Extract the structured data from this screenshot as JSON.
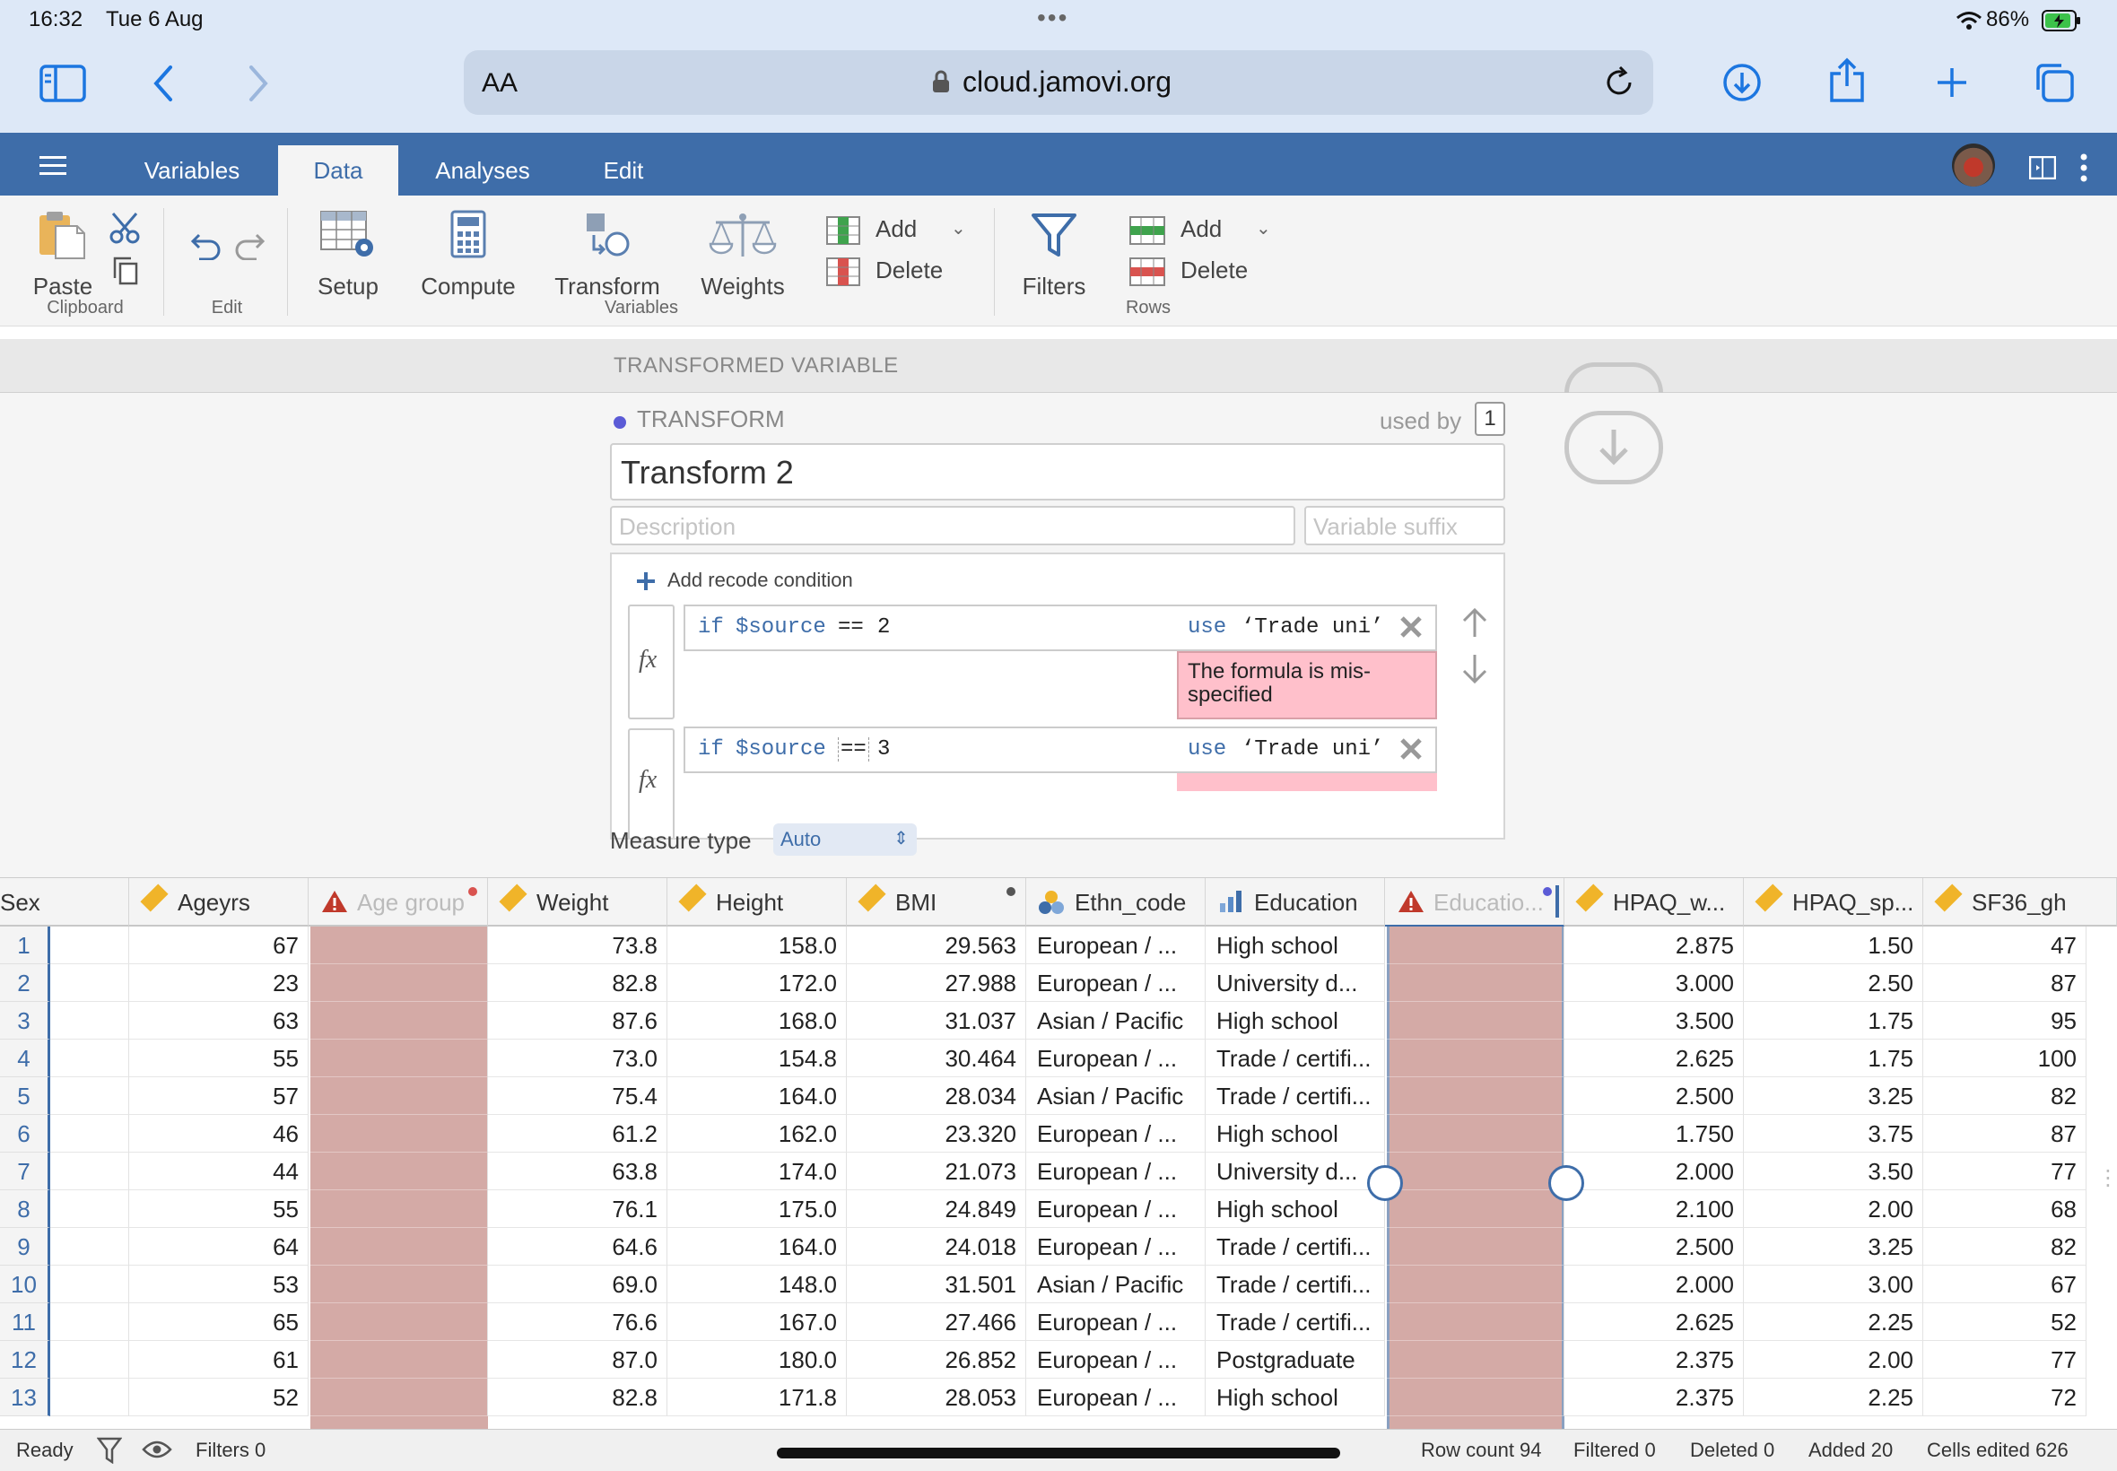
{
  "status": {
    "time": "16:32",
    "date": "Tue 6 Aug",
    "battery": "86%"
  },
  "browser": {
    "aa": "AA",
    "url": "cloud.jamovi.org"
  },
  "tabs": [
    {
      "label": "Variables",
      "active": false
    },
    {
      "label": "Data",
      "active": true
    },
    {
      "label": "Analyses",
      "active": false
    },
    {
      "label": "Edit",
      "active": false
    }
  ],
  "toolbar": {
    "paste": "Paste",
    "clipboard": "Clipboard",
    "edit": "Edit",
    "setup": "Setup",
    "compute": "Compute",
    "transform": "Transform",
    "weights": "Weights",
    "add_var": "Add",
    "delete_var": "Delete",
    "variables": "Variables",
    "filters": "Filters",
    "add_row": "Add",
    "delete_row": "Delete",
    "rows": "Rows"
  },
  "panel": {
    "header": "TRANSFORMED VARIABLE",
    "transform_label": "TRANSFORM",
    "used_by": "used by",
    "used_by_count": "1",
    "name": "Transform 2",
    "description_placeholder": "Description",
    "suffix_placeholder": "Variable suffix",
    "add_condition": "Add recode condition",
    "conditions": [
      {
        "kw": "if",
        "var": "$source",
        "op": "==",
        "val": "2",
        "use": "use",
        "result": "‘Trade uni’",
        "error": "The formula is mis-specified"
      },
      {
        "kw": "if",
        "var": "$source",
        "op": "==",
        "val": "3",
        "use": "use",
        "result": "‘Trade uni’",
        "error": ""
      }
    ],
    "measure_label": "Measure type",
    "measure_value": "Auto"
  },
  "grid": {
    "columns": [
      "Sex",
      "Ageyrs",
      "Age group",
      "Weight",
      "Height",
      "BMI",
      "Ethn_code",
      "Education",
      "Educatio...",
      "HPAQ_w...",
      "HPAQ_sp...",
      "SF36_gh"
    ],
    "rows": [
      {
        "n": "1",
        "age": "67",
        "weight": "73.8",
        "height": "158.0",
        "bmi": "29.563",
        "ethn": "European / ...",
        "edu": "High school",
        "hw": "2.875",
        "hs": "1.50",
        "sf": "47"
      },
      {
        "n": "2",
        "age": "23",
        "weight": "82.8",
        "height": "172.0",
        "bmi": "27.988",
        "ethn": "European / ...",
        "edu": "University d...",
        "hw": "3.000",
        "hs": "2.50",
        "sf": "87"
      },
      {
        "n": "3",
        "age": "63",
        "weight": "87.6",
        "height": "168.0",
        "bmi": "31.037",
        "ethn": "Asian / Pacific",
        "edu": "High school",
        "hw": "3.500",
        "hs": "1.75",
        "sf": "95"
      },
      {
        "n": "4",
        "age": "55",
        "weight": "73.0",
        "height": "154.8",
        "bmi": "30.464",
        "ethn": "European / ...",
        "edu": "Trade / certifi...",
        "hw": "2.625",
        "hs": "1.75",
        "sf": "100"
      },
      {
        "n": "5",
        "age": "57",
        "weight": "75.4",
        "height": "164.0",
        "bmi": "28.034",
        "ethn": "Asian / Pacific",
        "edu": "Trade / certifi...",
        "hw": "2.500",
        "hs": "3.25",
        "sf": "82"
      },
      {
        "n": "6",
        "age": "46",
        "weight": "61.2",
        "height": "162.0",
        "bmi": "23.320",
        "ethn": "European / ...",
        "edu": "High school",
        "hw": "1.750",
        "hs": "3.75",
        "sf": "87"
      },
      {
        "n": "7",
        "age": "44",
        "weight": "63.8",
        "height": "174.0",
        "bmi": "21.073",
        "ethn": "European / ...",
        "edu": "University d...",
        "hw": "2.000",
        "hs": "3.50",
        "sf": "77"
      },
      {
        "n": "8",
        "age": "55",
        "weight": "76.1",
        "height": "175.0",
        "bmi": "24.849",
        "ethn": "European / ...",
        "edu": "High school",
        "hw": "2.100",
        "hs": "2.00",
        "sf": "68"
      },
      {
        "n": "9",
        "age": "64",
        "weight": "64.6",
        "height": "164.0",
        "bmi": "24.018",
        "ethn": "European / ...",
        "edu": "Trade / certifi...",
        "hw": "2.500",
        "hs": "3.25",
        "sf": "82"
      },
      {
        "n": "10",
        "age": "53",
        "weight": "69.0",
        "height": "148.0",
        "bmi": "31.501",
        "ethn": "Asian / Pacific",
        "edu": "Trade / certifi...",
        "hw": "2.000",
        "hs": "3.00",
        "sf": "67"
      },
      {
        "n": "11",
        "age": "65",
        "weight": "76.6",
        "height": "167.0",
        "bmi": "27.466",
        "ethn": "European / ...",
        "edu": "Trade / certifi...",
        "hw": "2.625",
        "hs": "2.25",
        "sf": "52"
      },
      {
        "n": "12",
        "age": "61",
        "weight": "87.0",
        "height": "180.0",
        "bmi": "26.852",
        "ethn": "European / ...",
        "edu": "Postgraduate",
        "hw": "2.375",
        "hs": "2.00",
        "sf": "77"
      },
      {
        "n": "13",
        "age": "52",
        "weight": "82.8",
        "height": "171.8",
        "bmi": "28.053",
        "ethn": "European / ...",
        "edu": "High school",
        "hw": "2.375",
        "hs": "2.25",
        "sf": "72"
      }
    ]
  },
  "statusbar": {
    "ready": "Ready",
    "filters": "Filters 0",
    "row_count": "Row count 94",
    "filtered": "Filtered 0",
    "deleted": "Deleted 0",
    "added": "Added 20",
    "cells_edited": "Cells edited 626"
  },
  "colors": {
    "ribbon": "#3e6da9",
    "error_bg": "#ffc0cb",
    "pink_col": "#d4aaa6",
    "accent": "#1c76e0"
  }
}
